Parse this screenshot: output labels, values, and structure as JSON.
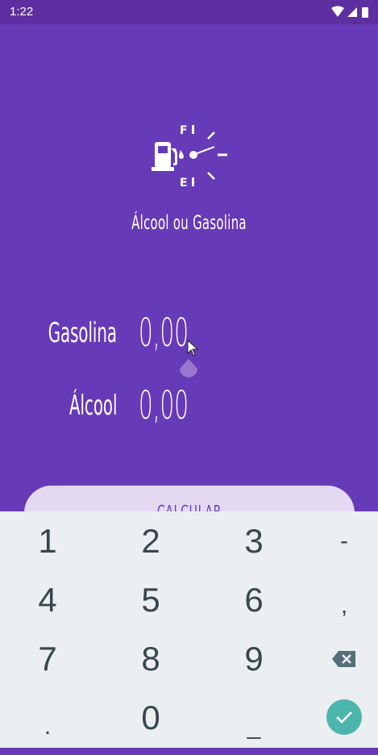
{
  "status_bar": {
    "time": "1:22"
  },
  "app": {
    "title": "Álcool ou Gasolina",
    "logo_top_letter": "F",
    "logo_bottom_letter": "E"
  },
  "form": {
    "gasoline_label": "Gasolina",
    "gasoline_value": "0,00",
    "alcohol_label": "Álcool",
    "alcohol_value": "0,00"
  },
  "button": {
    "label": "CALCULAR"
  },
  "keyboard": {
    "keys": [
      "1",
      "2",
      "3",
      "-",
      "4",
      "5",
      "6",
      ",",
      "7",
      "8",
      "9",
      ".",
      "0",
      "_"
    ],
    "backspace_icon": "backspace-icon",
    "done_icon": "check-icon"
  },
  "colors": {
    "background": "#673ab7",
    "status_bar": "#5e2fa0",
    "button_bg": "#e3d9f1",
    "keyboard_bg": "#eceff1",
    "done_key": "#4db6ac"
  }
}
